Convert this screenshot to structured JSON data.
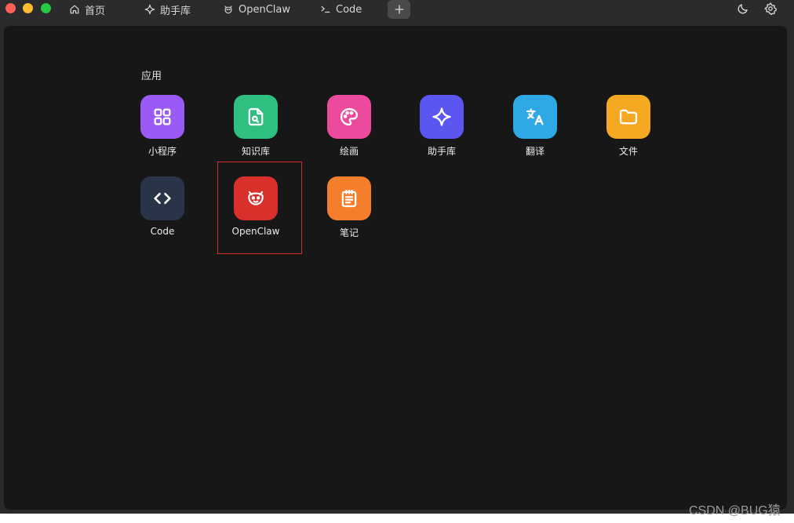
{
  "window": {
    "tabs": [
      {
        "label": "首页",
        "icon": "home-icon"
      },
      {
        "label": "助手库",
        "icon": "sparkle-icon"
      },
      {
        "label": "OpenClaw",
        "icon": "claw-icon"
      },
      {
        "label": "Code",
        "icon": "terminal-icon"
      }
    ],
    "new_tab_icon": "plus-icon",
    "theme_toggle_icon": "moon-icon",
    "settings_icon": "gear-icon"
  },
  "apps": {
    "section_title": "应用",
    "items": [
      {
        "label": "小程序",
        "icon": "grid-icon",
        "color": "#9b59f5"
      },
      {
        "label": "知识库",
        "icon": "document-search-icon",
        "color": "#2fbf7f"
      },
      {
        "label": "绘画",
        "icon": "palette-icon",
        "color": "#ec4a9c"
      },
      {
        "label": "助手库",
        "icon": "sparkle-icon",
        "color": "#5b56f0"
      },
      {
        "label": "翻译",
        "icon": "translate-icon",
        "color": "#2ea9e6"
      },
      {
        "label": "文件",
        "icon": "folder-icon",
        "color": "#f5a821"
      },
      {
        "label": "Code",
        "icon": "code-icon",
        "color": "#2a3448"
      },
      {
        "label": "OpenClaw",
        "icon": "claw-icon",
        "color": "#d9302c"
      },
      {
        "label": "笔记",
        "icon": "notepad-icon",
        "color": "#f47e2a"
      }
    ]
  },
  "highlight": {
    "color": "#d42a2a"
  },
  "watermark": "CSDN @BUG猿"
}
